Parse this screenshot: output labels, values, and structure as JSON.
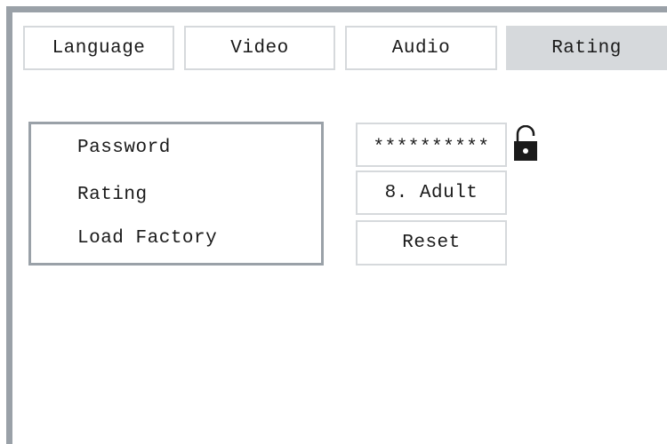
{
  "tabs": [
    {
      "label": "Language",
      "active": false
    },
    {
      "label": "Video",
      "active": false
    },
    {
      "label": "Audio",
      "active": false
    },
    {
      "label": "Rating",
      "active": true
    }
  ],
  "menu": {
    "items": [
      {
        "label": "Password"
      },
      {
        "label": "Rating"
      },
      {
        "label": "Load Factory"
      }
    ]
  },
  "values": {
    "password": "**********",
    "rating": "8. Adult",
    "reset": "Reset"
  },
  "icons": {
    "lock": "unlocked-padlock-icon"
  },
  "colors": {
    "frame": "#9aa1a8",
    "tab_border": "#d6d9dc",
    "active_tab_bg": "#d6d9dc",
    "text": "#1a1a1a",
    "background": "#ffffff"
  }
}
